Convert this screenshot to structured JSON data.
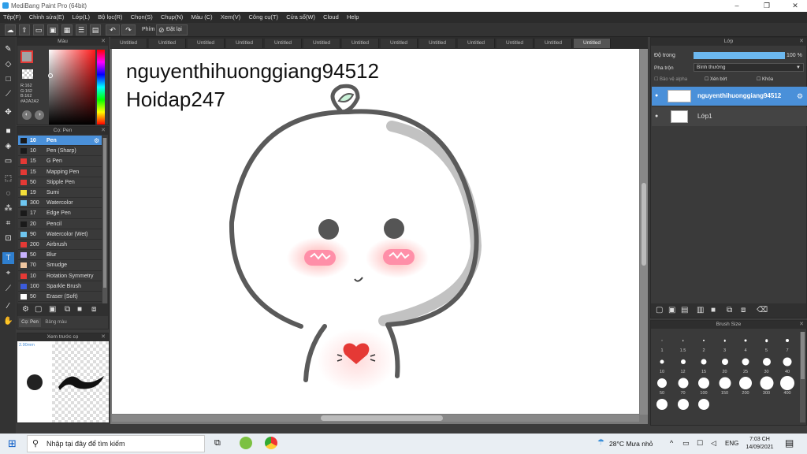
{
  "window": {
    "title": "MediBang Paint Pro (64bit)",
    "minimize": "–",
    "maximize": "❐",
    "close": "✕"
  },
  "menu": [
    "Tệp(F)",
    "Chỉnh sửa(E)",
    "Lớp(L)",
    "Bộ lọc(R)",
    "Chọn(S)",
    "Chụp(N)",
    "Màu (C)",
    "Xem(V)",
    "Công cụ(T)",
    "Cửa sổ(W)",
    "Cloud",
    "Help"
  ],
  "toolbar": {
    "phim_label": "Phím",
    "undo_label": "Đặt lại"
  },
  "color_panel": {
    "title": "Màu",
    "r": "R:162",
    "g": "G:162",
    "b": "B:162",
    "hex": "#A2A2A2"
  },
  "brush_panel": {
    "title": "Cọ: Pen",
    "brushes": [
      {
        "size": "10",
        "name": "Pen",
        "color": "#1a1a1a",
        "selected": true
      },
      {
        "size": "10",
        "name": "Pen (Sharp)",
        "color": "#1a1a1a"
      },
      {
        "size": "15",
        "name": "G Pen",
        "color": "#e53935"
      },
      {
        "size": "15",
        "name": "Mapping Pen",
        "color": "#e53935"
      },
      {
        "size": "50",
        "name": "Stipple Pen",
        "color": "#e53935"
      },
      {
        "size": "19",
        "name": "Sumi",
        "color": "#f5e03a"
      },
      {
        "size": "300",
        "name": "Watercolor",
        "color": "#6ec6f0"
      },
      {
        "size": "17",
        "name": "Edge Pen",
        "color": "#1a1a1a"
      },
      {
        "size": "20",
        "name": "Pencil",
        "color": "#1a1a1a"
      },
      {
        "size": "90",
        "name": "Watercolor (Wet)",
        "color": "#6ec6f0"
      },
      {
        "size": "200",
        "name": "Airbrush",
        "color": "#e53935"
      },
      {
        "size": "50",
        "name": "Blur",
        "color": "#c9b3ff"
      },
      {
        "size": "70",
        "name": "Smudge",
        "color": "#f0c7a0"
      },
      {
        "size": "10",
        "name": "Rotation Symmetry",
        "color": "#e53935"
      },
      {
        "size": "100",
        "name": "Sparkle Brush",
        "color": "#3b5bdb"
      },
      {
        "size": "50",
        "name": "Eraser (Soft)",
        "color": "#ffffff"
      }
    ],
    "tab_brush": "Cọ: Pen",
    "tab_color": "Bảng màu"
  },
  "preview_panel": {
    "title": "Xem trước cọ",
    "size": "2.90mm"
  },
  "tabs": [
    "Untitled",
    "Untitled",
    "Untitled",
    "Untitled",
    "Untitled",
    "Untitled",
    "Untitled",
    "Untitled",
    "Untitled",
    "Untitled",
    "Untitled",
    "Untitled",
    "Untitled"
  ],
  "canvas": {
    "line1": "nguyenthihuonggiang94512",
    "line2": "Hoidap247"
  },
  "layer_panel": {
    "title": "Lớp",
    "opacity_label": "Độ trong",
    "opacity_value": "100 %",
    "blend_label": "Pha trộn",
    "blend_value": "Bình thường",
    "protect_alpha": "Bảo vệ alpha",
    "clipping": "Xén bớt",
    "lock": "Khóa",
    "layers": [
      {
        "name": "nguyenthihuonggiang94512",
        "selected": true
      },
      {
        "name": "Lớp1",
        "selected": false
      }
    ]
  },
  "brush_size_panel": {
    "title": "Brush Size",
    "sizes": [
      "1",
      "1.5",
      "2",
      "3",
      "4",
      "5",
      "7",
      "10",
      "12",
      "15",
      "20",
      "25",
      "30",
      "40",
      "50",
      "70",
      "100",
      "150",
      "200",
      "300",
      "400",
      "",
      "",
      ""
    ]
  },
  "taskbar": {
    "search_placeholder": "Nhập tại đây để tìm kiếm",
    "weather": "28°C Mưa nhỏ",
    "lang": "ENG",
    "time": "7:03 CH",
    "date": "14/09/2021"
  }
}
